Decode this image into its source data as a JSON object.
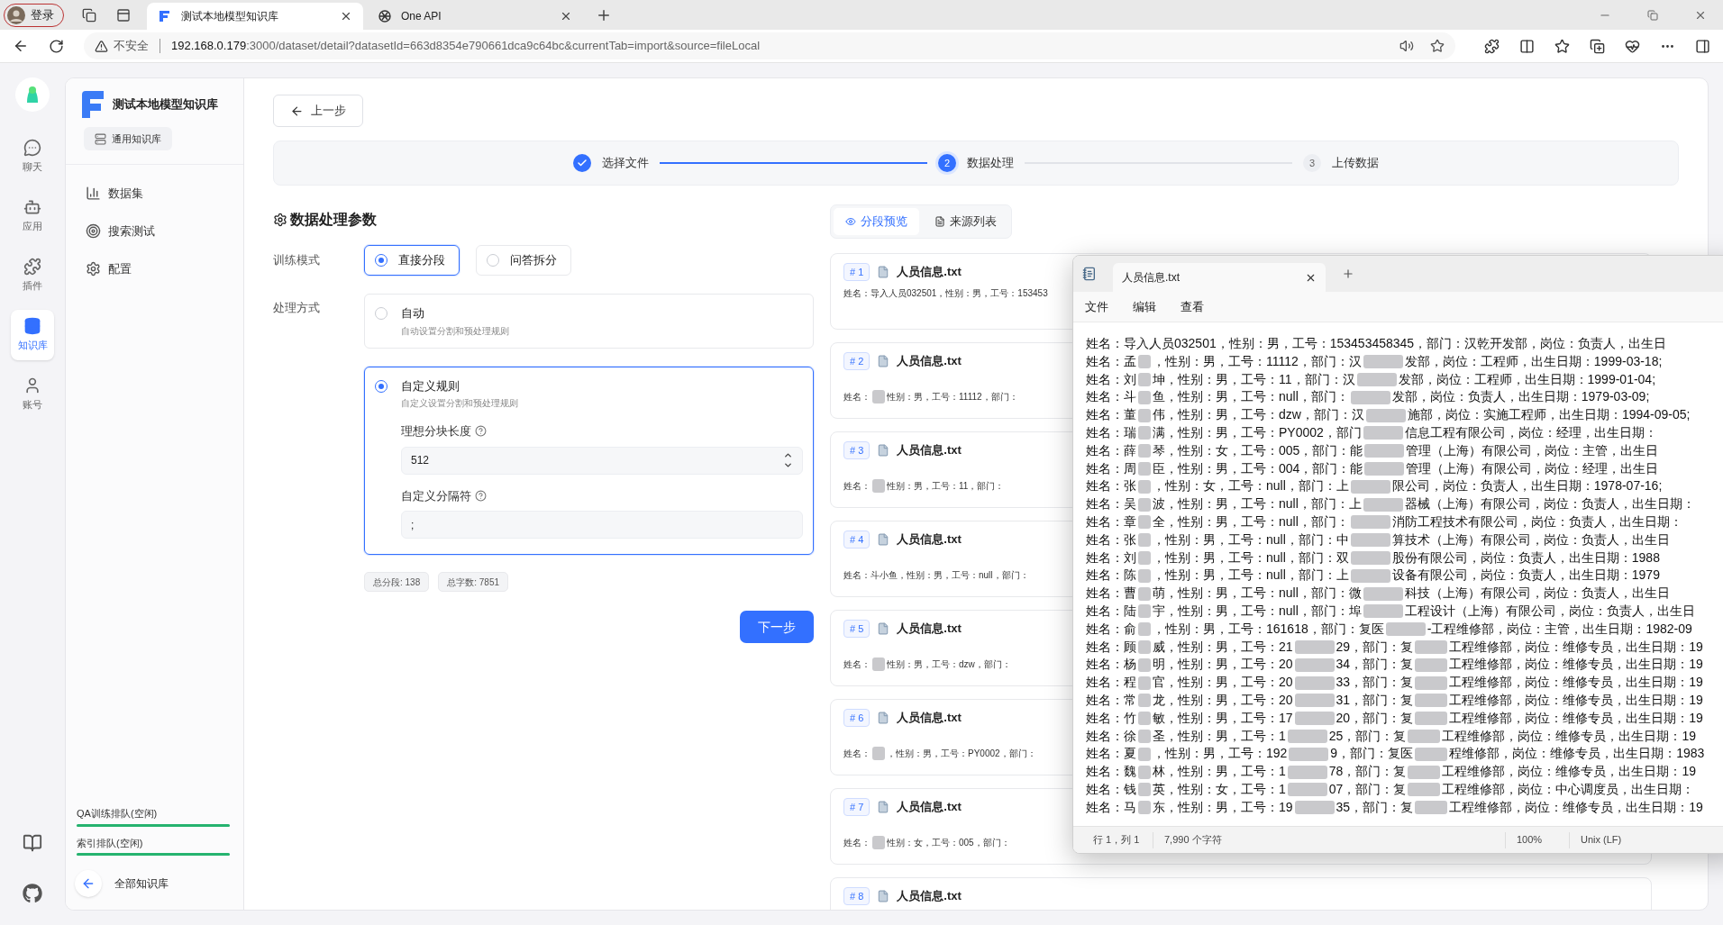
{
  "browser": {
    "profile": {
      "label": "登录"
    },
    "tabs": [
      {
        "title": "测试本地模型知识库",
        "selected": true,
        "kind": "app"
      },
      {
        "title": "One API",
        "selected": false,
        "kind": "knot"
      }
    ],
    "address": {
      "warning": "不安全",
      "host": "192.168.0.179",
      "path": ":3000/dataset/detail?datasetId=663d8354e790661dca9c64bc&currentTab=import&source=fileLocal"
    }
  },
  "rail": {
    "items": [
      {
        "label": "聊天",
        "kind": "chat",
        "selected": false
      },
      {
        "label": "应用",
        "kind": "app",
        "selected": false
      },
      {
        "label": "插件",
        "kind": "plugin",
        "selected": false
      },
      {
        "label": "知识库",
        "kind": "dataset",
        "selected": true
      },
      {
        "label": "账号",
        "kind": "account",
        "selected": false
      }
    ]
  },
  "sidebar": {
    "title": "测试本地模型知识库",
    "type_badge": "通用知识库",
    "items": [
      {
        "label": "数据集",
        "kind": "dataset"
      },
      {
        "label": "搜索测试",
        "kind": "search"
      },
      {
        "label": "配置",
        "kind": "config"
      }
    ],
    "queues": [
      {
        "label": "QA训练排队(空闲)",
        "level": 1
      },
      {
        "label": "索引排队(空闲)",
        "level": 1
      }
    ],
    "back_link": "全部知识库"
  },
  "back_button": "上一步",
  "steps": [
    {
      "label": "选择文件",
      "completed": true,
      "selected": false
    },
    {
      "number": "2",
      "label": "数据处理",
      "completed": false,
      "selected": true
    },
    {
      "number": "3",
      "label": "上传数据",
      "completed": false,
      "selected": false
    }
  ],
  "params": {
    "title": "数据处理参数",
    "training_mode": {
      "label": "训练模式",
      "options": [
        {
          "label": "直接分段",
          "selected": true
        },
        {
          "label": "问答拆分",
          "selected": false
        }
      ]
    },
    "process_method": {
      "label": "处理方式",
      "options": [
        {
          "label": "自动",
          "description": "自动设置分割和预处理规则",
          "selected": false
        },
        {
          "label": "自定义规则",
          "description": "自定义设置分割和预处理规则",
          "selected": true,
          "fields": [
            {
              "label": "理想分块长度",
              "kind": "number",
              "value": "512"
            },
            {
              "label": "自定义分隔符",
              "kind": "text",
              "value": ";"
            }
          ]
        }
      ]
    },
    "stats": [
      "总分段: 138",
      "总字数: 7851"
    ],
    "next_button": "下一步"
  },
  "preview": {
    "tabs": [
      {
        "label": "分段预览",
        "selected": true,
        "kind": "eye"
      },
      {
        "label": "来源列表",
        "selected": false,
        "kind": "list"
      }
    ],
    "chunks": [
      {
        "index": "# 1",
        "file": "人员信息.txt",
        "segments": [
          "姓名：导入人员032501，性别：男，工号：153453"
        ]
      },
      {
        "index": "# 2",
        "file": "人员信息.txt",
        "segments": [
          "姓名：",
          "性别：男，工号：11112，部门："
        ]
      },
      {
        "index": "# 3",
        "file": "人员信息.txt",
        "segments": [
          "姓名：",
          "性别：男，工号：11，部门："
        ]
      },
      {
        "index": "# 4",
        "file": "人员信息.txt",
        "segments": [
          "姓名：斗小鱼，性别：男，工号：null，部门："
        ]
      },
      {
        "index": "# 5",
        "file": "人员信息.txt",
        "segments": [
          "姓名：",
          "性别：男，工号：dzw，部门："
        ]
      },
      {
        "index": "# 6",
        "file": "人员信息.txt",
        "segments": [
          "姓名：",
          "，性别：男，工号：PY0002，部门："
        ]
      },
      {
        "index": "# 7",
        "file": "人员信息.txt",
        "segments": [
          "姓名：",
          "性别：女，工号：005，部门："
        ]
      },
      {
        "index": "# 8",
        "file": "人员信息.txt"
      }
    ]
  },
  "notepad": {
    "tab_title": "人员信息.txt",
    "menu": [
      "文件",
      "编辑",
      "查看"
    ],
    "lines": [
      {
        "segments": [
          "姓名：导入人员032501，性别：男，工号：153453458345，部门：汉乾开发部，岗位：负责人，出生日"
        ]
      },
      {
        "segments": [
          "姓名：孟",
          "，性别：男，工号：11112，部门：汉",
          "发部，岗位：工程师，出生日期：1999-03-18;"
        ]
      },
      {
        "segments": [
          "姓名：刘",
          "坤，性别：男，工号：11，部门：汉",
          "发部，岗位：工程师，出生日期：1999-01-04;"
        ]
      },
      {
        "segments": [
          "姓名：斗",
          "鱼，性别：男，工号：null，部门：",
          "发部，岗位：负责人，出生日期：1979-03-09;"
        ]
      },
      {
        "segments": [
          "姓名：董",
          "伟，性别：男，工号：dzw，部门：汉",
          "施部，岗位：实施工程师，出生日期：1994-09-05;"
        ]
      },
      {
        "segments": [
          "姓名：瑞",
          "满，性别：男，工号：PY0002，部门",
          "信息工程有限公司，岗位：经理，出生日期："
        ]
      },
      {
        "segments": [
          "姓名：薛",
          "琴，性别：女，工号：005，部门：能",
          "管理（上海）有限公司，岗位：主管，出生日"
        ]
      },
      {
        "segments": [
          "姓名：周",
          "臣，性别：男，工号：004，部门：能",
          "管理（上海）有限公司，岗位：经理，出生日"
        ]
      },
      {
        "segments": [
          "姓名：张",
          "，性别：女，工号：null，部门：上",
          "限公司，岗位：负责人，出生日期：1978-07-16;"
        ]
      },
      {
        "segments": [
          "姓名：吴",
          "波，性别：男，工号：null，部门：上",
          "器械（上海）有限公司，岗位：负责人，出生日期："
        ]
      },
      {
        "segments": [
          "姓名：章",
          "全，性别：男，工号：null，部门：",
          "消防工程技术有限公司，岗位：负责人，出生日期："
        ]
      },
      {
        "segments": [
          "姓名：张",
          "，性别：男，工号：null，部门：中",
          "算技术（上海）有限公司，岗位：负责人，出生日"
        ]
      },
      {
        "segments": [
          "姓名：刘",
          "，性别：男，工号：null，部门：双",
          "股份有限公司，岗位：负责人，出生日期：1988"
        ]
      },
      {
        "segments": [
          "姓名：陈",
          "，性别：男，工号：null，部门：上",
          "设备有限公司，岗位：负责人，出生日期：1979"
        ]
      },
      {
        "segments": [
          "姓名：曹",
          "萌，性别：男，工号：null，部门：微",
          "科技（上海）有限公司，岗位：负责人，出生日"
        ]
      },
      {
        "segments": [
          "姓名：陆",
          "宇，性别：男，工号：null，部门：埠",
          "工程设计（上海）有限公司，岗位：负责人，出生日"
        ]
      },
      {
        "segments": [
          "姓名：俞",
          "，性别：男，工号：161618，部门：复医",
          "-工程维修部，岗位：主管，出生日期：1982-09"
        ]
      },
      {
        "segments": [
          "姓名：顾",
          "威，性别：男，工号：21",
          "29，部门：复",
          "工程维修部，岗位：维修专员，出生日期：19"
        ]
      },
      {
        "segments": [
          "姓名：杨",
          "明，性别：男，工号：20",
          "34，部门：复",
          "工程维修部，岗位：维修专员，出生日期：19"
        ]
      },
      {
        "segments": [
          "姓名：程",
          "官，性别：男，工号：20",
          "33，部门：复",
          "工程维修部，岗位：维修专员，出生日期：19"
        ]
      },
      {
        "segments": [
          "姓名：常",
          "龙，性别：男，工号：20",
          "31，部门：复",
          "工程维修部，岗位：维修专员，出生日期：19"
        ]
      },
      {
        "segments": [
          "姓名：竹",
          "敏，性别：男，工号：17",
          "20，部门：复",
          "工程维修部，岗位：维修专员，出生日期：19"
        ]
      },
      {
        "segments": [
          "姓名：徐",
          "圣，性别：男，工号：1",
          "25，部门：复",
          "工程维修部，岗位：维修专员，出生日期：19"
        ]
      },
      {
        "segments": [
          "姓名：夏",
          "，性别：男，工号：192",
          "9，部门：复医",
          "程维修部，岗位：维修专员，出生日期：1983"
        ]
      },
      {
        "segments": [
          "姓名：魏",
          "林，性别：男，工号：1",
          "78，部门：复",
          "工程维修部，岗位：维修专员，出生日期：19"
        ]
      },
      {
        "segments": [
          "姓名：钱",
          "英，性别：女，工号：1",
          "07，部门：复",
          "工程维修部，岗位：中心调度员，出生日期："
        ]
      },
      {
        "segments": [
          "姓名：马",
          "东，性别：男，工号：19",
          "35，部门：复",
          "工程维修部，岗位：维修专员，出生日期：19"
        ]
      }
    ],
    "status": {
      "position": "行 1，列 1",
      "chars": "7,990 个字符",
      "zoom": "100%",
      "line_ending": "Unix (LF)"
    }
  }
}
